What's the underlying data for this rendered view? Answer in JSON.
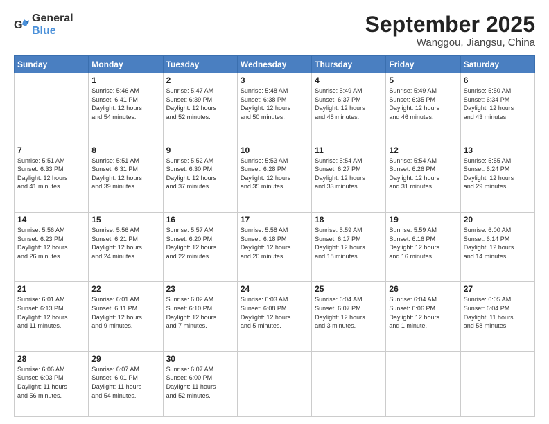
{
  "logo": {
    "general": "General",
    "blue": "Blue"
  },
  "title": {
    "main": "September 2025",
    "sub": "Wanggou, Jiangsu, China"
  },
  "calendar": {
    "headers": [
      "Sunday",
      "Monday",
      "Tuesday",
      "Wednesday",
      "Thursday",
      "Friday",
      "Saturday"
    ],
    "rows": [
      [
        {
          "day": "",
          "info": "",
          "empty": true
        },
        {
          "day": "1",
          "info": "Sunrise: 5:46 AM\nSunset: 6:41 PM\nDaylight: 12 hours\nand 54 minutes."
        },
        {
          "day": "2",
          "info": "Sunrise: 5:47 AM\nSunset: 6:39 PM\nDaylight: 12 hours\nand 52 minutes."
        },
        {
          "day": "3",
          "info": "Sunrise: 5:48 AM\nSunset: 6:38 PM\nDaylight: 12 hours\nand 50 minutes."
        },
        {
          "day": "4",
          "info": "Sunrise: 5:49 AM\nSunset: 6:37 PM\nDaylight: 12 hours\nand 48 minutes."
        },
        {
          "day": "5",
          "info": "Sunrise: 5:49 AM\nSunset: 6:35 PM\nDaylight: 12 hours\nand 46 minutes."
        },
        {
          "day": "6",
          "info": "Sunrise: 5:50 AM\nSunset: 6:34 PM\nDaylight: 12 hours\nand 43 minutes."
        }
      ],
      [
        {
          "day": "7",
          "info": "Sunrise: 5:51 AM\nSunset: 6:33 PM\nDaylight: 12 hours\nand 41 minutes."
        },
        {
          "day": "8",
          "info": "Sunrise: 5:51 AM\nSunset: 6:31 PM\nDaylight: 12 hours\nand 39 minutes."
        },
        {
          "day": "9",
          "info": "Sunrise: 5:52 AM\nSunset: 6:30 PM\nDaylight: 12 hours\nand 37 minutes."
        },
        {
          "day": "10",
          "info": "Sunrise: 5:53 AM\nSunset: 6:28 PM\nDaylight: 12 hours\nand 35 minutes."
        },
        {
          "day": "11",
          "info": "Sunrise: 5:54 AM\nSunset: 6:27 PM\nDaylight: 12 hours\nand 33 minutes."
        },
        {
          "day": "12",
          "info": "Sunrise: 5:54 AM\nSunset: 6:26 PM\nDaylight: 12 hours\nand 31 minutes."
        },
        {
          "day": "13",
          "info": "Sunrise: 5:55 AM\nSunset: 6:24 PM\nDaylight: 12 hours\nand 29 minutes."
        }
      ],
      [
        {
          "day": "14",
          "info": "Sunrise: 5:56 AM\nSunset: 6:23 PM\nDaylight: 12 hours\nand 26 minutes."
        },
        {
          "day": "15",
          "info": "Sunrise: 5:56 AM\nSunset: 6:21 PM\nDaylight: 12 hours\nand 24 minutes."
        },
        {
          "day": "16",
          "info": "Sunrise: 5:57 AM\nSunset: 6:20 PM\nDaylight: 12 hours\nand 22 minutes."
        },
        {
          "day": "17",
          "info": "Sunrise: 5:58 AM\nSunset: 6:18 PM\nDaylight: 12 hours\nand 20 minutes."
        },
        {
          "day": "18",
          "info": "Sunrise: 5:59 AM\nSunset: 6:17 PM\nDaylight: 12 hours\nand 18 minutes."
        },
        {
          "day": "19",
          "info": "Sunrise: 5:59 AM\nSunset: 6:16 PM\nDaylight: 12 hours\nand 16 minutes."
        },
        {
          "day": "20",
          "info": "Sunrise: 6:00 AM\nSunset: 6:14 PM\nDaylight: 12 hours\nand 14 minutes."
        }
      ],
      [
        {
          "day": "21",
          "info": "Sunrise: 6:01 AM\nSunset: 6:13 PM\nDaylight: 12 hours\nand 11 minutes."
        },
        {
          "day": "22",
          "info": "Sunrise: 6:01 AM\nSunset: 6:11 PM\nDaylight: 12 hours\nand 9 minutes."
        },
        {
          "day": "23",
          "info": "Sunrise: 6:02 AM\nSunset: 6:10 PM\nDaylight: 12 hours\nand 7 minutes."
        },
        {
          "day": "24",
          "info": "Sunrise: 6:03 AM\nSunset: 6:08 PM\nDaylight: 12 hours\nand 5 minutes."
        },
        {
          "day": "25",
          "info": "Sunrise: 6:04 AM\nSunset: 6:07 PM\nDaylight: 12 hours\nand 3 minutes."
        },
        {
          "day": "26",
          "info": "Sunrise: 6:04 AM\nSunset: 6:06 PM\nDaylight: 12 hours\nand 1 minute."
        },
        {
          "day": "27",
          "info": "Sunrise: 6:05 AM\nSunset: 6:04 PM\nDaylight: 11 hours\nand 58 minutes."
        }
      ],
      [
        {
          "day": "28",
          "info": "Sunrise: 6:06 AM\nSunset: 6:03 PM\nDaylight: 11 hours\nand 56 minutes."
        },
        {
          "day": "29",
          "info": "Sunrise: 6:07 AM\nSunset: 6:01 PM\nDaylight: 11 hours\nand 54 minutes."
        },
        {
          "day": "30",
          "info": "Sunrise: 6:07 AM\nSunset: 6:00 PM\nDaylight: 11 hours\nand 52 minutes."
        },
        {
          "day": "",
          "info": "",
          "empty": true
        },
        {
          "day": "",
          "info": "",
          "empty": true
        },
        {
          "day": "",
          "info": "",
          "empty": true
        },
        {
          "day": "",
          "info": "",
          "empty": true
        }
      ]
    ]
  }
}
